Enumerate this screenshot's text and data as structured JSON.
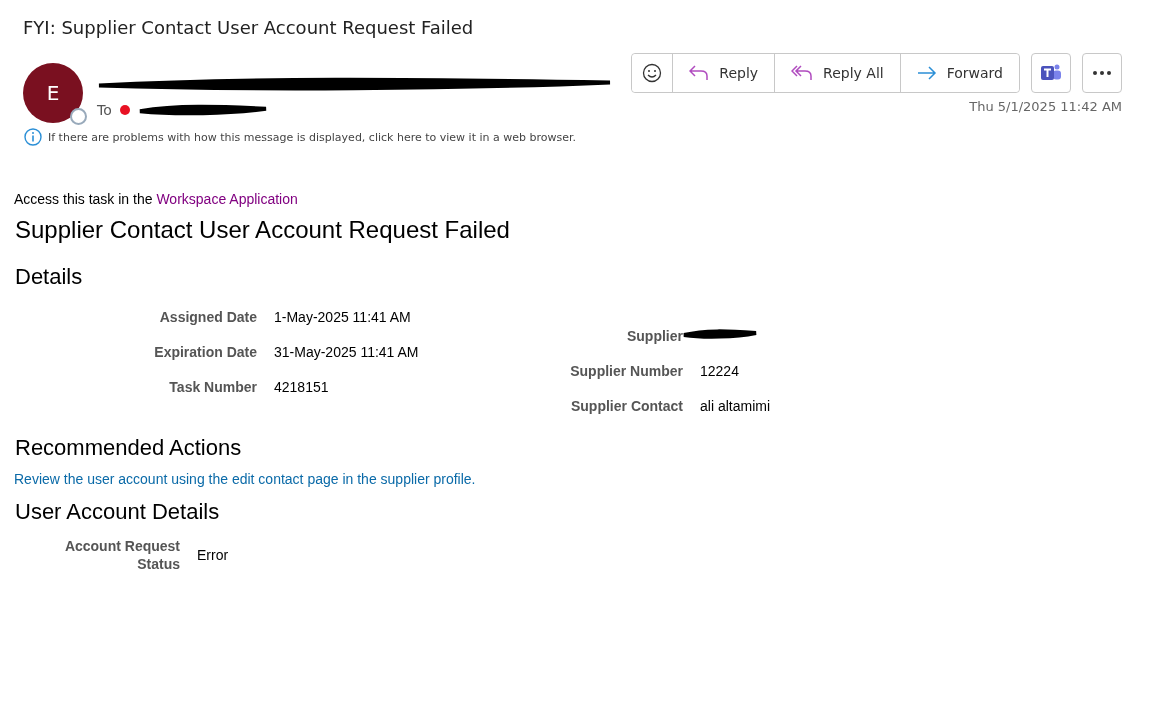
{
  "subject": "FYI: Supplier Contact User Account Request Failed",
  "sender": {
    "initial": "E",
    "online": false,
    "redacted": true
  },
  "recipients": {
    "label": "To",
    "redacted": true
  },
  "actions": [
    {
      "kind": "emoji"
    },
    {
      "kind": "reply",
      "label": "Reply"
    },
    {
      "kind": "reply_all",
      "label": "Reply All"
    },
    {
      "kind": "forward",
      "label": "Forward"
    }
  ],
  "extra_buttons": [
    {
      "kind": "teams"
    },
    {
      "kind": "more"
    }
  ],
  "date": "Thu 5/1/2025 11:42 AM",
  "info_bar": "If there are problems with how this message is displayed, click here to view it in a web browser.",
  "access": {
    "text": "Access this task in the",
    "link": "Workspace Application"
  },
  "heading": "Supplier Contact User Account Request Failed",
  "details": {
    "title": "Details",
    "left": [
      {
        "label": "Assigned Date",
        "value": "1-May-2025 11:41 AM"
      },
      {
        "label": "Expiration Date",
        "value": "31-May-2025 11:41 AM"
      },
      {
        "label": "Task Number",
        "value": "4218151"
      }
    ],
    "right": [
      {
        "label": "Supplier",
        "redacted": true
      },
      {
        "label": "Supplier Number",
        "value": "12224"
      },
      {
        "label": "Supplier Contact",
        "value": "ali altamimi"
      }
    ]
  },
  "recommended": {
    "title": "Recommended Actions",
    "link": "Review the user account using the edit contact page in the supplier profile."
  },
  "account": {
    "title": "User Account Details",
    "rows": [
      {
        "label": "Account Request Status",
        "value": "Error"
      }
    ]
  }
}
